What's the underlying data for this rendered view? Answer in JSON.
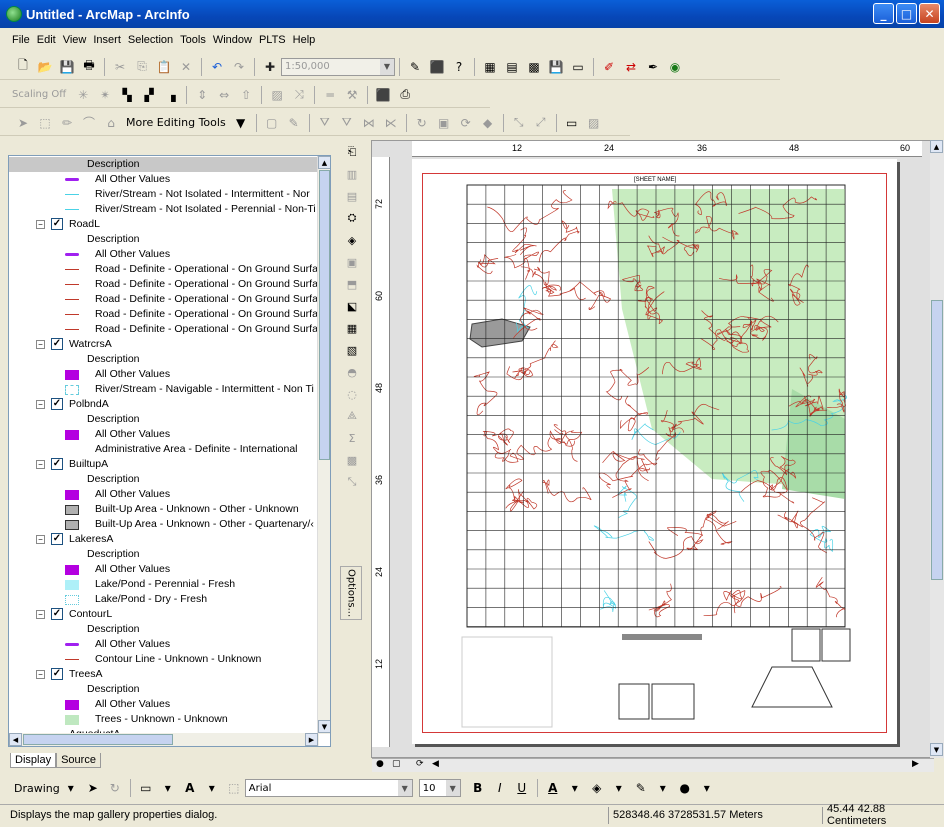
{
  "app": {
    "title": "Untitled - ArcMap - ArcInfo"
  },
  "menu": [
    "File",
    "Edit",
    "View",
    "Insert",
    "Selection",
    "Tools",
    "Window",
    "PLTS",
    "Help"
  ],
  "toolbar1": {
    "scale": "1:50,000"
  },
  "toolbar2": {
    "scaling": "Scaling Off"
  },
  "toolbar3": {
    "more_editing": "More Editing Tools"
  },
  "toc": {
    "header": "Description",
    "rows": [
      {
        "type": "sym",
        "text": "All Other Values",
        "sym": "line-purple"
      },
      {
        "type": "sym",
        "text": "River/Stream - Not Isolated - Intermittent - Nor",
        "sym": "line-cyan"
      },
      {
        "type": "sym",
        "text": "River/Stream - Not Isolated - Perennial - Non-Ti",
        "sym": "line-cyan"
      },
      {
        "type": "layer",
        "text": "RoadL"
      },
      {
        "type": "desc",
        "text": "Description"
      },
      {
        "type": "sym",
        "text": "All Other Values",
        "sym": "line-purple"
      },
      {
        "type": "sym",
        "text": "Road - Definite - Operational - On Ground Surfa",
        "sym": "line-red"
      },
      {
        "type": "sym",
        "text": "Road - Definite - Operational - On Ground Surfa",
        "sym": "line-red"
      },
      {
        "type": "sym",
        "text": "Road - Definite - Operational - On Ground Surfa",
        "sym": "line-red"
      },
      {
        "type": "sym",
        "text": "Road - Definite - Operational - On Ground Surfa",
        "sym": "line-red"
      },
      {
        "type": "sym",
        "text": "Road - Definite - Operational - On Ground Surfa",
        "sym": "line-red"
      },
      {
        "type": "layer",
        "text": "WatrcrsA"
      },
      {
        "type": "desc",
        "text": "Description"
      },
      {
        "type": "sym",
        "text": "All Other Values",
        "sym": "fill-purple"
      },
      {
        "type": "sym",
        "text": "River/Stream - Navigable - Intermittent - Non Ti",
        "sym": "fill-dash"
      },
      {
        "type": "layer",
        "text": "PolbndA"
      },
      {
        "type": "desc",
        "text": "Description"
      },
      {
        "type": "sym",
        "text": "All Other Values",
        "sym": "fill-purple"
      },
      {
        "type": "sym",
        "text": "Administrative Area - Definite - International",
        "sym": "none"
      },
      {
        "type": "layer",
        "text": "BuiltupA"
      },
      {
        "type": "desc",
        "text": "Description"
      },
      {
        "type": "sym",
        "text": "All Other Values",
        "sym": "fill-purple"
      },
      {
        "type": "sym",
        "text": "Built-Up Area - Unknown - Other - Unknown",
        "sym": "fill-gray"
      },
      {
        "type": "sym",
        "text": "Built-Up Area - Unknown - Other - Quartenary/‹",
        "sym": "fill-gray"
      },
      {
        "type": "layer",
        "text": "LakeresA"
      },
      {
        "type": "desc",
        "text": "Description"
      },
      {
        "type": "sym",
        "text": "All Other Values",
        "sym": "fill-purple"
      },
      {
        "type": "sym",
        "text": "Lake/Pond - Perennial - Fresh",
        "sym": "fill-cyan"
      },
      {
        "type": "sym",
        "text": "Lake/Pond - Dry - Fresh",
        "sym": "fill-dot"
      },
      {
        "type": "layer",
        "text": "ContourL"
      },
      {
        "type": "desc",
        "text": "Description"
      },
      {
        "type": "sym",
        "text": "All Other Values",
        "sym": "line-purple"
      },
      {
        "type": "sym",
        "text": "Contour Line - Unknown - Unknown",
        "sym": "line-red"
      },
      {
        "type": "layer",
        "text": "TreesA"
      },
      {
        "type": "desc",
        "text": "Description"
      },
      {
        "type": "sym",
        "text": "All Other Values",
        "sym": "fill-purple"
      },
      {
        "type": "sym",
        "text": "Trees - Unknown - Unknown",
        "sym": "fill-green"
      }
    ],
    "partial": "AqueductA"
  },
  "tabs": {
    "display": "Display",
    "source": "Source"
  },
  "options": "Options...",
  "ruler_h": [
    "12",
    "24",
    "36",
    "48",
    "60"
  ],
  "ruler_v": [
    "72",
    "60",
    "48",
    "36",
    "24",
    "12"
  ],
  "map": {
    "sheet_name": "[SHEET NAME]"
  },
  "drawing": {
    "label": "Drawing",
    "font": "Arial",
    "size": "10",
    "bold": "B",
    "italic": "I",
    "underline": "U"
  },
  "status": {
    "message": "Displays the map gallery properties dialog.",
    "coords": "528348.46  3728531.57 Meters",
    "page": "45.44  42.88 Centimeters"
  },
  "colors": {
    "title": "#0a5fd8",
    "accent_red": "#d43838",
    "contour": "#c0392b",
    "green": "#c8ecc0"
  }
}
